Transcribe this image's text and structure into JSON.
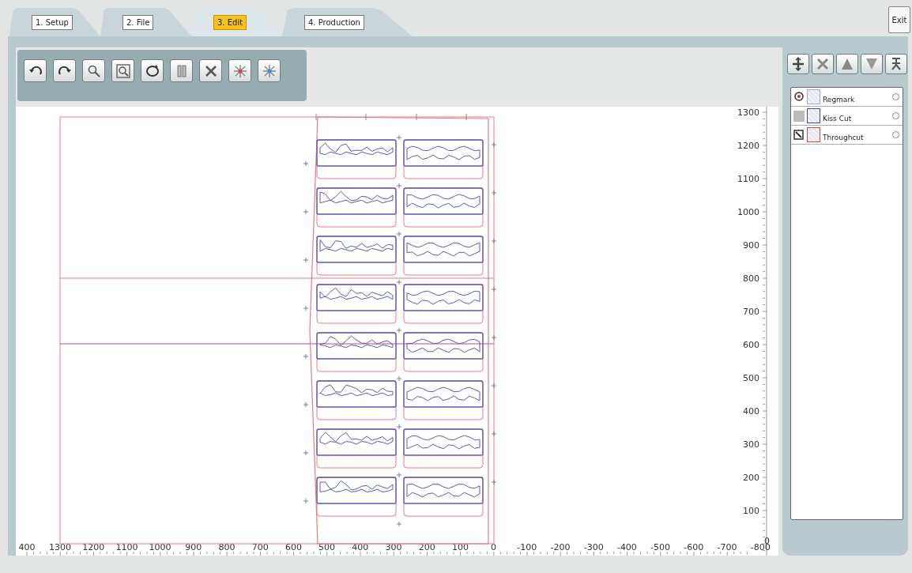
{
  "tabs": [
    {
      "label": "1. Setup",
      "selected": false
    },
    {
      "label": "2. File",
      "selected": false
    },
    {
      "label": "3. Edit",
      "selected": true
    },
    {
      "label": "4. Production",
      "selected": false
    }
  ],
  "exit_button": {
    "label": "Exit"
  },
  "x_ruler": [
    "400",
    "1300",
    "1200",
    "1100",
    "1000",
    "900",
    "800",
    "700",
    "600",
    "500",
    "400",
    "300",
    "200",
    "100",
    "0",
    "-100",
    "-200",
    "-300",
    "-400",
    "-500",
    "-600",
    "-700",
    "-800"
  ],
  "y_ruler": [
    "1300",
    "1200",
    "1100",
    "1000",
    "900",
    "800",
    "700",
    "600",
    "500",
    "400",
    "300",
    "200",
    "100",
    "0"
  ],
  "layers": [
    {
      "name": "Regmark",
      "kind": "regmark",
      "color": "#a8a8d8",
      "selected": false
    },
    {
      "name": "Kiss Cut",
      "kind": "kisscut",
      "color": "#4646b0",
      "selected": false
    },
    {
      "name": "Throughcut",
      "kind": "throughcut",
      "color": "#d84a4a",
      "selected": false
    }
  ]
}
